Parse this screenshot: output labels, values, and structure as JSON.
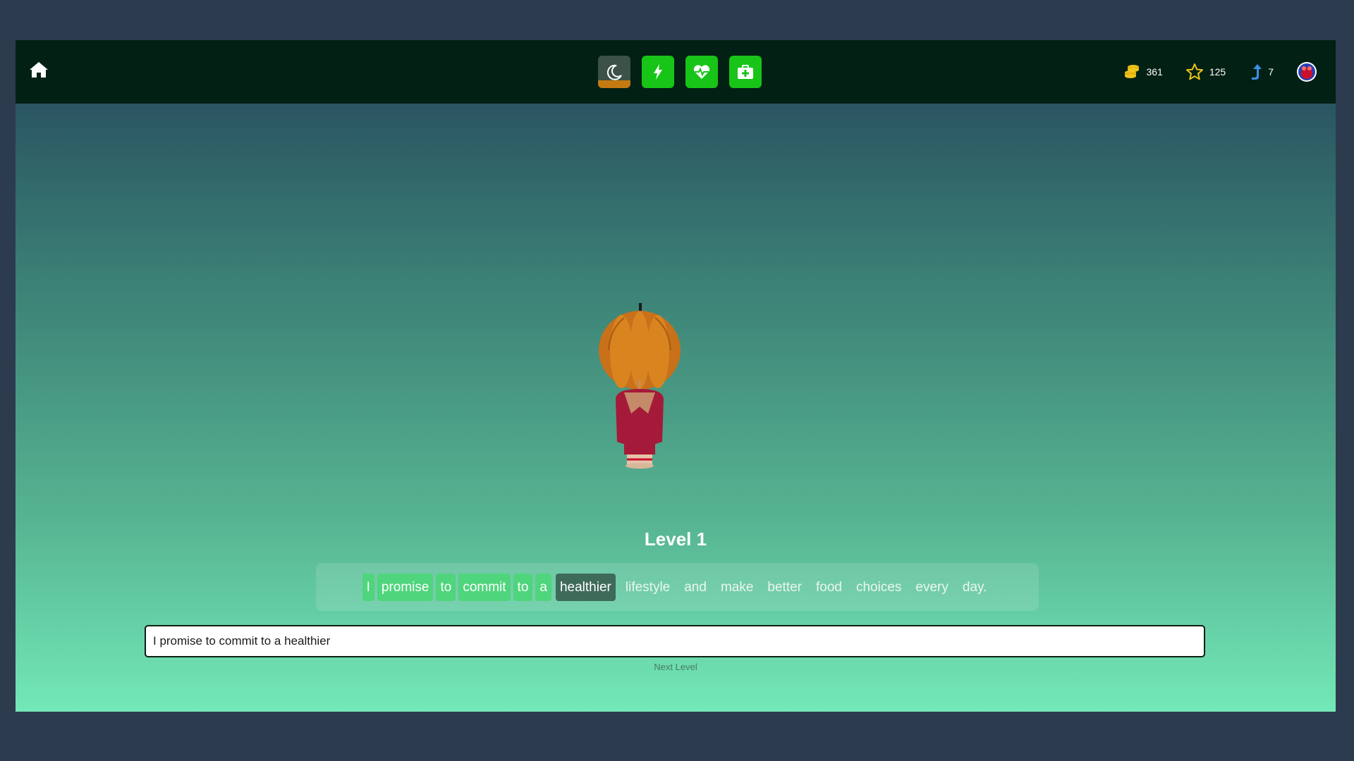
{
  "topbar": {
    "icons": {
      "home": "home-icon",
      "sleep": "moon-icon",
      "energy": "lightning-icon",
      "health": "heart-pulse-icon",
      "medical": "medical-kit-icon",
      "coins": "coins-icon",
      "stars": "star-icon",
      "level": "arrow-up-icon",
      "avatar": "avatar-icon"
    },
    "sleep_level": 0.25,
    "stats": {
      "coins": "361",
      "stars": "125",
      "level": "7"
    }
  },
  "colors": {
    "topbar_bg": "#022014",
    "status_green": "#17c417",
    "sleep_orange": "#c47a10",
    "word_done": "#4fd57c",
    "word_current": "#3e6a5a"
  },
  "game": {
    "level_title": "Level 1",
    "sentence": [
      {
        "text": "I",
        "state": "done"
      },
      {
        "text": "promise",
        "state": "done"
      },
      {
        "text": "to",
        "state": "done"
      },
      {
        "text": "commit",
        "state": "done"
      },
      {
        "text": "to",
        "state": "done"
      },
      {
        "text": "a",
        "state": "done"
      },
      {
        "text": "healthier",
        "state": "current"
      },
      {
        "text": "lifestyle",
        "state": "pending"
      },
      {
        "text": "and",
        "state": "pending"
      },
      {
        "text": "make",
        "state": "pending"
      },
      {
        "text": "better",
        "state": "pending"
      },
      {
        "text": "food",
        "state": "pending"
      },
      {
        "text": "choices",
        "state": "pending"
      },
      {
        "text": "every",
        "state": "pending"
      },
      {
        "text": "day.",
        "state": "pending"
      }
    ],
    "input_value": "I promise to commit to a healthier",
    "next_level_label": "Next Level"
  }
}
